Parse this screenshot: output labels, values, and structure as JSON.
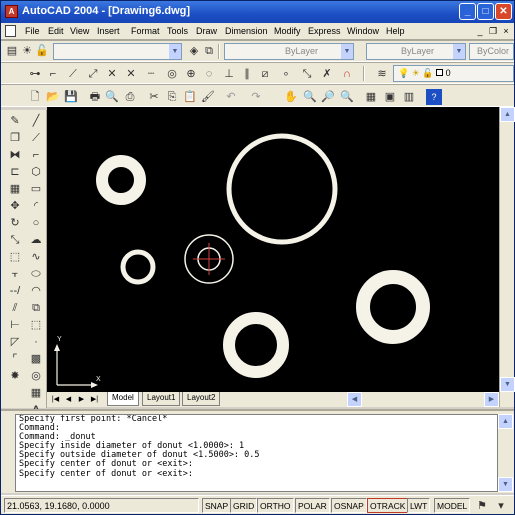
{
  "window": {
    "title": "AutoCAD 2004 - [Drawing6.dwg]"
  },
  "menubar": {
    "items": [
      "File",
      "Edit",
      "View",
      "Insert",
      "Format",
      "Tools",
      "Draw",
      "Dimension",
      "Modify",
      "Express",
      "Window",
      "Help"
    ]
  },
  "layers": {
    "layer_combo": "",
    "color_combo": "ByLayer",
    "linetype_combo": "ByLayer",
    "lineweight_combo": "ByLayer",
    "plotstyle_combo": "ByColor",
    "layer_name": "0"
  },
  "tabs": {
    "items": [
      "Model",
      "Layout1",
      "Layout2"
    ],
    "active": "Model"
  },
  "command": {
    "lines": [
      "Specify first point: *Cancel*",
      "Command:",
      "Command: _donut",
      "Specify inside diameter of donut <1.0000>: 1",
      "Specify outside diameter of donut <1.5000>: 0.5",
      "Specify center of donut or <exit>:",
      "Specify center of donut or <exit>:"
    ]
  },
  "status": {
    "coords": "21.0563, 19.1680, 0.0000",
    "buttons": [
      "SNAP",
      "GRID",
      "ORTHO",
      "POLAR",
      "OSNAP",
      "OTRACK",
      "LWT",
      "MODEL"
    ]
  },
  "drawing": {
    "background": "#000000",
    "donut_color": "#f5f2e8",
    "cursor_color": "#d04040",
    "ucs_labels": {
      "x": "X",
      "y": "Y"
    }
  }
}
